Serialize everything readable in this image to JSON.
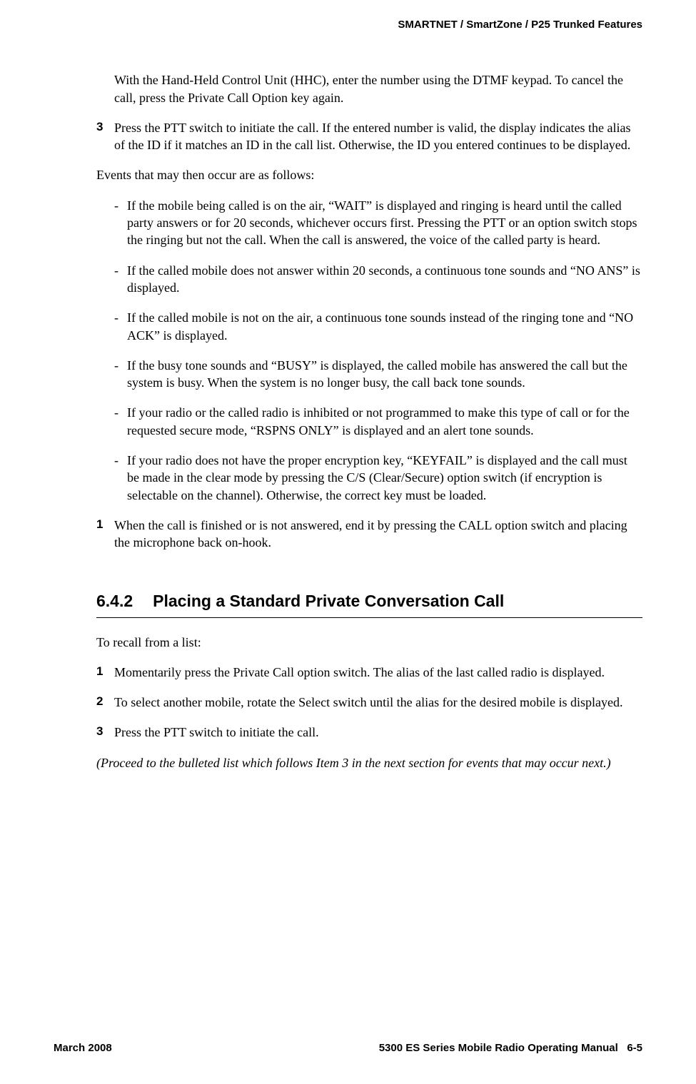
{
  "header": {
    "title": "SMARTNET / SmartZone / P25 Trunked Features"
  },
  "content": {
    "intro_para": "With the Hand-Held Control Unit (HHC), enter the number using the DTMF keypad. To cancel the call, press the Private Call Option key again.",
    "step3_num": "3",
    "step3_text": "Press the PTT switch to initiate the call. If the entered number is valid, the display indicates the alias of the ID if it matches an ID in the call list. Otherwise, the ID you entered continues to be displayed.",
    "events_intro": "Events that may then occur are as follows:",
    "bullets": [
      "If the mobile being called is on the air, “WAIT” is displayed and ringing is heard until the called party answers or for 20 seconds, whichever occurs first. Pressing the PTT or an option switch stops the ringing but not the call. When the call is answered, the voice of the called party is heard.",
      "If the called mobile does not answer within 20 seconds, a continuous tone sounds and “NO ANS” is displayed.",
      "If the called mobile is not on the air, a continuous tone sounds instead of the ringing tone and “NO ACK” is displayed.",
      "If the busy tone sounds and “BUSY” is displayed, the called mobile has answered the call but the system is busy. When the system is no longer busy, the call back tone sounds.",
      "If your radio or the called radio is inhibited or not programmed to make this type of call or for the requested secure mode, “RSPNS ONLY” is displayed and an alert tone sounds.",
      "If your radio does not have the proper encryption key, “KEYFAIL” is displayed and the call must be made in the clear mode by pressing the C/S (Clear/Secure) option switch (if encryption is selectable on the channel). Otherwise, the correct key must be loaded."
    ],
    "step1_num": "1",
    "step1_text": "When the call is finished or is not answered, end it by pressing the CALL option switch and placing the microphone back on-hook.",
    "section": {
      "number": "6.4.2",
      "title": "Placing a Standard Private Conversation Call"
    },
    "recall_intro": "To recall from a list:",
    "recall_steps": [
      {
        "num": "1",
        "text": "Momentarily press the Private Call option switch. The alias of the last called radio is displayed."
      },
      {
        "num": "2",
        "text": "To select another mobile, rotate the Select switch until the alias for the desired mobile is displayed."
      },
      {
        "num": "3",
        "text": "Press the PTT switch to initiate the call."
      }
    ],
    "proceed_note": "(Proceed to the bulleted list which follows Item 3 in the next section for events that may occur next.)"
  },
  "footer": {
    "left": "March 2008",
    "right_manual": "5300 ES Series Mobile Radio Operating Manual",
    "right_page": "6-5"
  }
}
